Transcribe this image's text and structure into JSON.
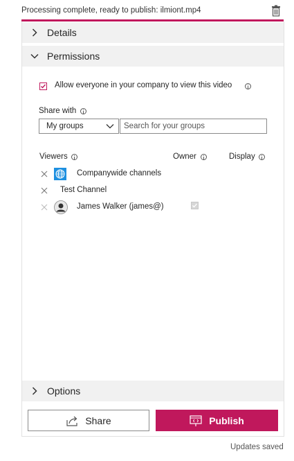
{
  "header": {
    "status": "Processing complete, ready to publish: ilmiont.mp4"
  },
  "sections": {
    "details": "Details",
    "permissions": "Permissions",
    "options": "Options"
  },
  "permissions": {
    "allow_label": "Allow everyone in your company to view this video",
    "share_with_label": "Share with",
    "share_with_value": "My groups",
    "search_placeholder": "Search for your groups",
    "columns": {
      "viewers": "Viewers",
      "owner": "Owner",
      "display": "Display"
    },
    "viewers": [
      {
        "name": "Companywide channels",
        "icon": "globe-icon"
      },
      {
        "name": "Test Channel",
        "icon": ""
      },
      {
        "name": "James Walker (james@)",
        "icon": "avatar"
      }
    ]
  },
  "actions": {
    "share": "Share",
    "publish": "Publish"
  },
  "footer": {
    "saved": "Updates saved"
  },
  "colors": {
    "accent": "#c0185c",
    "globe": "#1e90e0"
  }
}
